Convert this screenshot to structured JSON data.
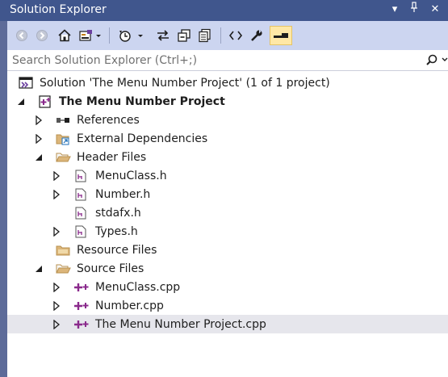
{
  "window": {
    "title": "Solution Explorer",
    "title_buttons": [
      "▾",
      "⊥",
      "✕"
    ]
  },
  "toolbar": {
    "buttons": [
      "back-icon",
      "forward-icon",
      "home-icon",
      "switch-views-icon",
      "pending-changes-filter-icon",
      "sync-with-active-document-icon",
      "collapse-all-icon",
      "show-all-files-icon",
      "view-code-icon",
      "properties-icon",
      "preview-selected-items-icon"
    ]
  },
  "search": {
    "placeholder": "Search Solution Explorer (Ctrl+;)"
  },
  "tree": {
    "solution": "Solution 'The Menu Number Project' (1 of 1 project)",
    "project": "The Menu Number Project",
    "references": "References",
    "external_dependencies": "External Dependencies",
    "header_files": "Header Files",
    "menuclass_h": "MenuClass.h",
    "number_h": "Number.h",
    "stdafx_h": "stdafx.h",
    "types_h": "Types.h",
    "resource_files": "Resource Files",
    "source_files": "Source Files",
    "menuclass_cpp": "MenuClass.cpp",
    "number_cpp": "Number.cpp",
    "project_cpp": "The Menu Number Project.cpp"
  },
  "colors": {
    "title_bar": "#40568d",
    "toolbar": "#ccd5f0",
    "selected_row": "#e6e6ec",
    "cpp_icon": "#8a2a8c"
  }
}
